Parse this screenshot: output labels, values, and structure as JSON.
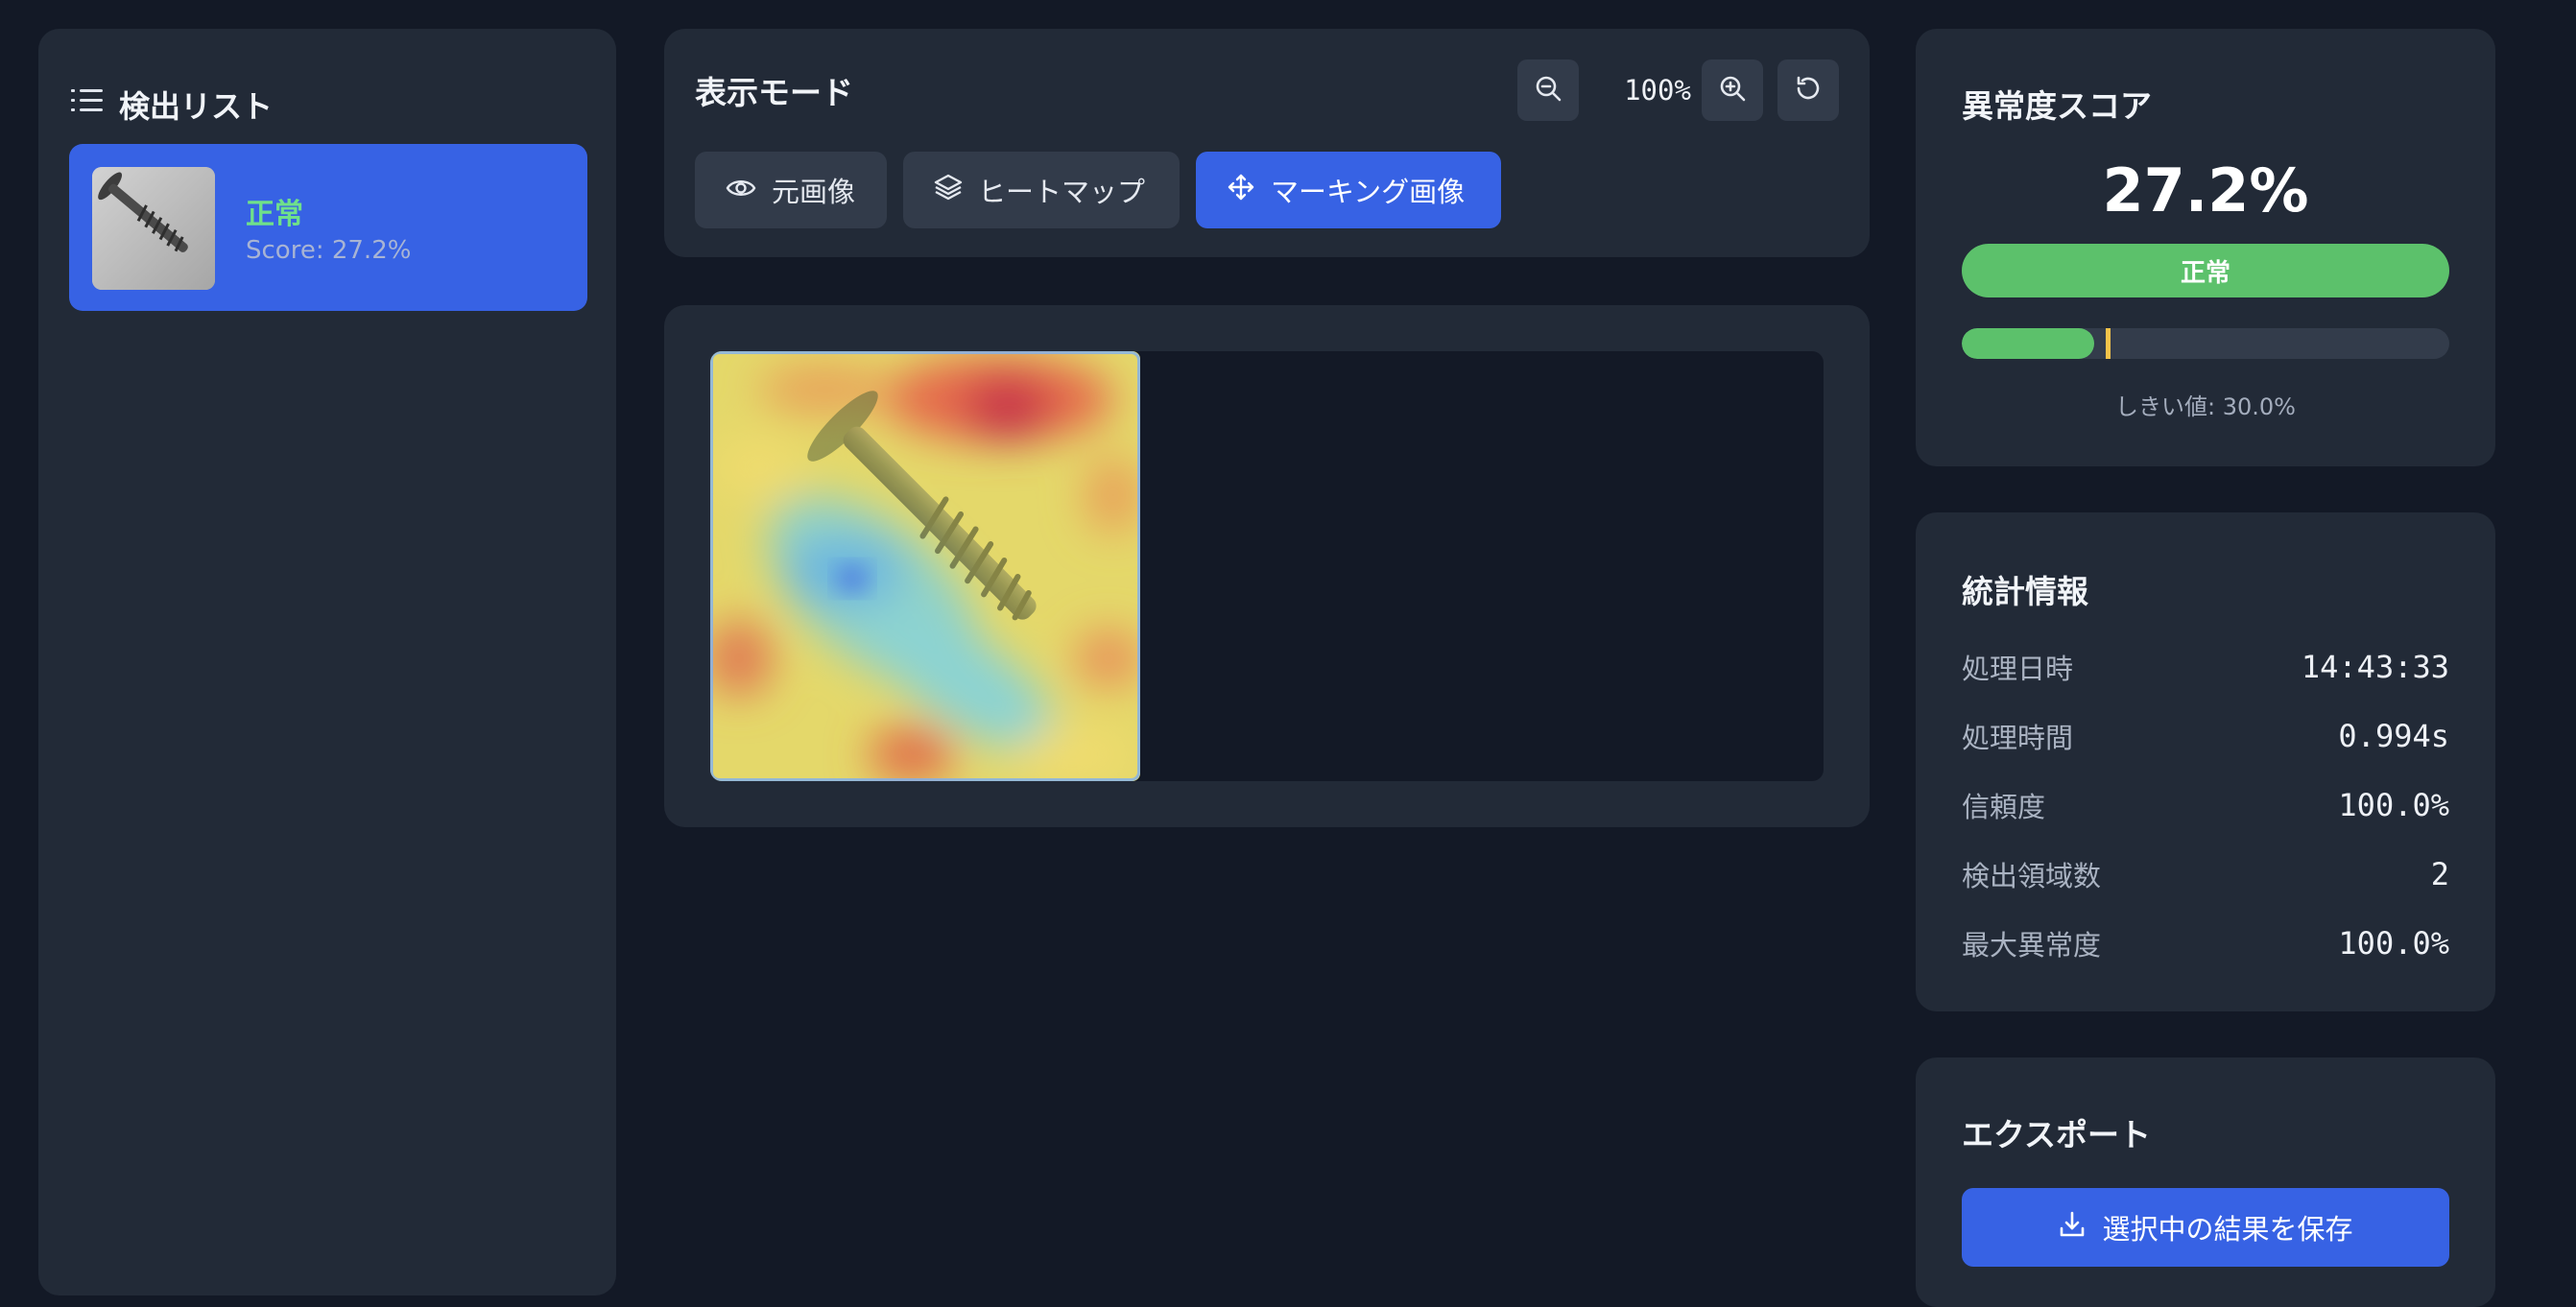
{
  "sidebar": {
    "title": "検出リスト",
    "icon": "list-icon",
    "items": [
      {
        "status": "正常",
        "score": "Score: 27.2%",
        "thumbnail": "screw-thumbnail"
      }
    ]
  },
  "view_mode": {
    "title": "表示モード",
    "zoom": "100%",
    "buttons": [
      {
        "label": "元画像",
        "icon": "eye-icon"
      },
      {
        "label": "ヒートマップ",
        "icon": "layers-icon"
      },
      {
        "label": "マーキング画像",
        "icon": "move-icon",
        "active": true
      }
    ]
  },
  "score": {
    "title": "異常度スコア",
    "value": "27.2%",
    "badge": "正常",
    "fraction": 0.272,
    "threshold_fraction": 0.3,
    "threshold_label": "しきい値: 30.0%"
  },
  "stats": {
    "title": "統計情報",
    "rows": [
      {
        "label": "処理日時",
        "value": "14:43:33"
      },
      {
        "label": "処理時間",
        "value": "0.994s"
      },
      {
        "label": "信頼度",
        "value": "100.0%"
      },
      {
        "label": "検出領域数",
        "value": "2"
      },
      {
        "label": "最大異常度",
        "value": "100.0%"
      }
    ]
  },
  "export": {
    "title": "エクスポート",
    "button": "選択中の結果を保存",
    "icon": "download-icon"
  },
  "colors": {
    "accent": "#3762e4",
    "normal": "#5cc16b",
    "threshold": "#f5c34a"
  }
}
